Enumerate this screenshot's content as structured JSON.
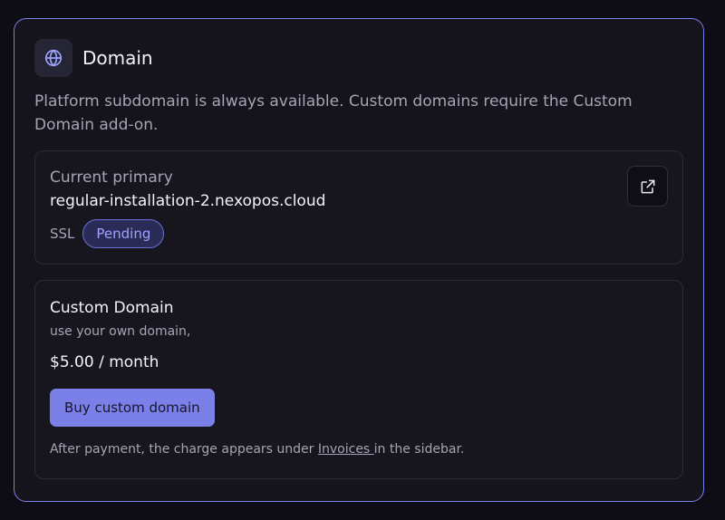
{
  "domain_card": {
    "title": "Domain",
    "icon": "globe-icon",
    "description": "Platform subdomain is always available. Custom domains require the Custom Domain add-on.",
    "accent_color": "#7b80e8"
  },
  "primary": {
    "label": "Current primary",
    "domain": "regular-installation-2.nexopos.cloud",
    "ssl_label": "SSL",
    "ssl_status": "Pending",
    "open_icon": "external-link-icon"
  },
  "addon": {
    "title": "Custom Domain",
    "subtitle": "use your own domain,",
    "price": "$5.00 / month",
    "buy_label": "Buy custom domain",
    "note_before": "After payment, the charge appears under ",
    "note_link": "Invoices ",
    "note_after": "in the sidebar."
  }
}
